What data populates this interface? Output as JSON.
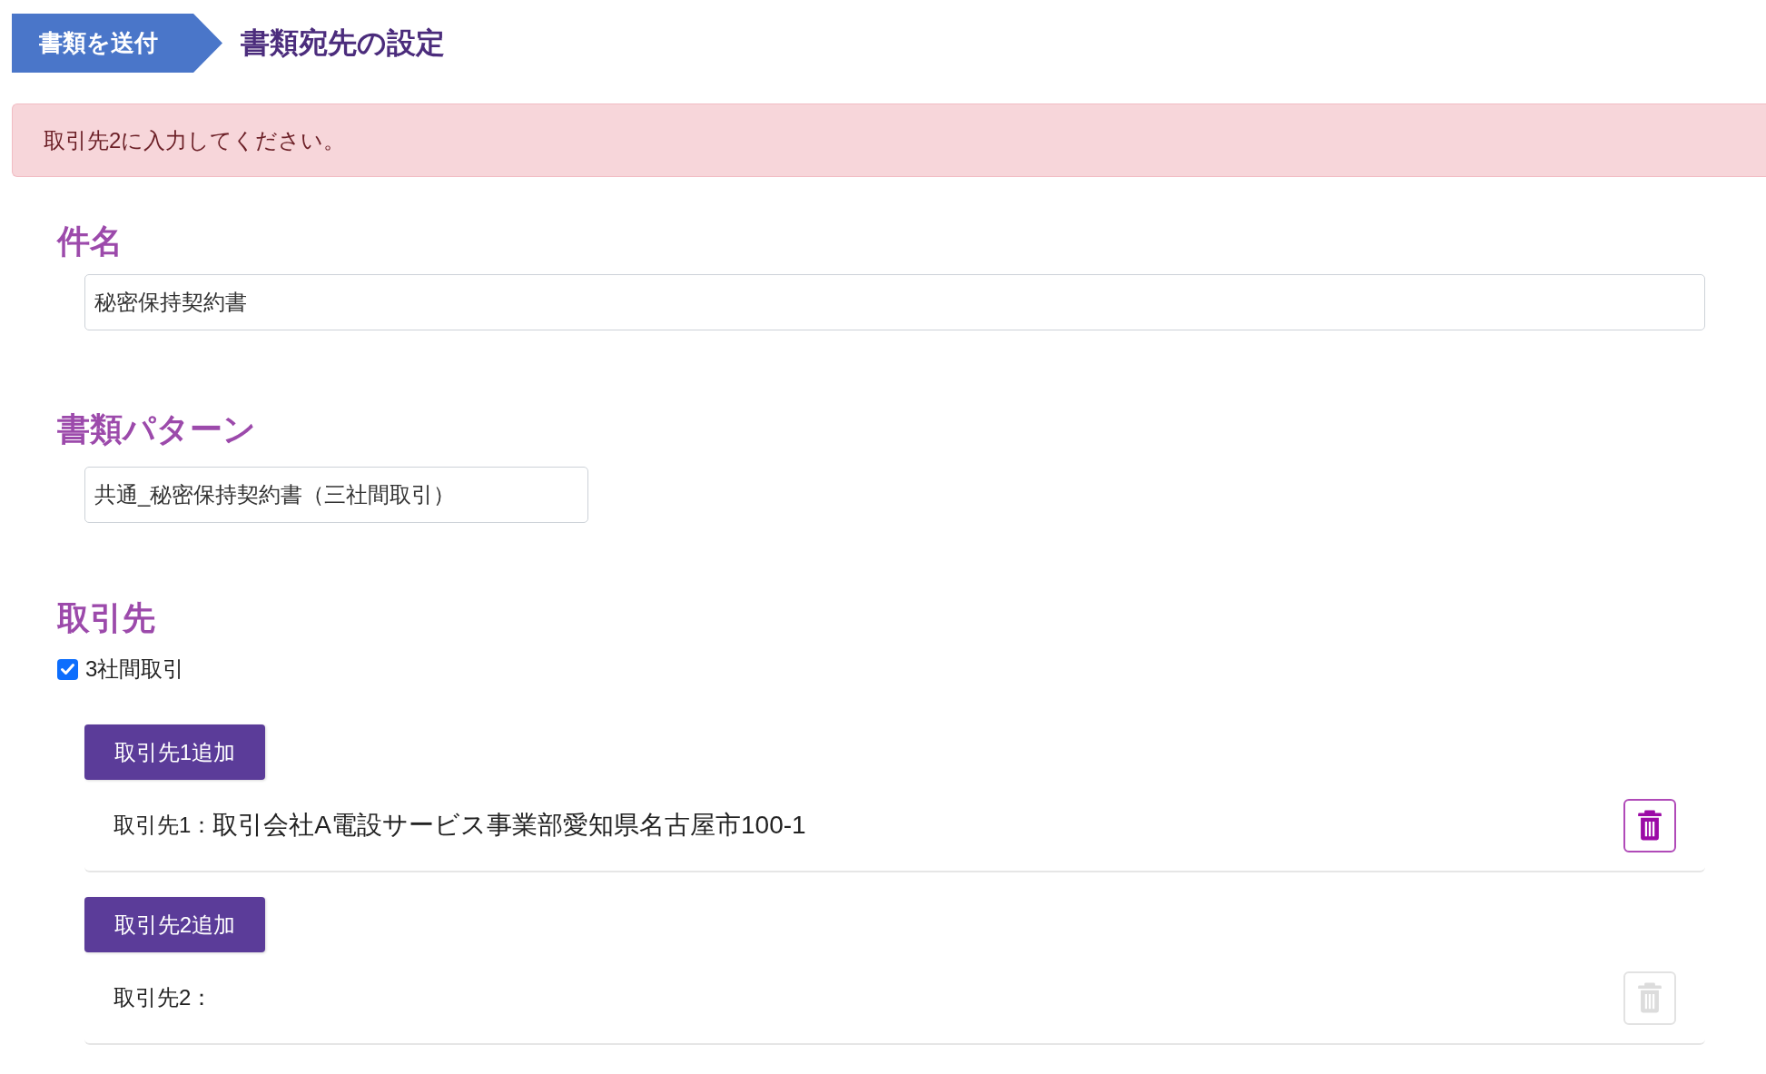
{
  "breadcrumb": {
    "step": "書類を送付",
    "title": "書類宛先の設定"
  },
  "alert": {
    "message": "取引先2に入力してください。"
  },
  "subject": {
    "label": "件名",
    "value": "秘密保持契約書"
  },
  "document_pattern": {
    "label": "書類パターン",
    "value": "共通_秘密保持契約書（三社間取引）"
  },
  "partners": {
    "label": "取引先",
    "three_party": {
      "label": "3社間取引",
      "checked": true
    },
    "entries": [
      {
        "button": "取引先1追加",
        "label": "取引先1：",
        "value": "取引会社A電設サービス事業部愛知県名古屋市100-1",
        "delete_disabled": false
      },
      {
        "button": "取引先2追加",
        "label": "取引先2：",
        "delete_disabled": true
      }
    ]
  }
}
